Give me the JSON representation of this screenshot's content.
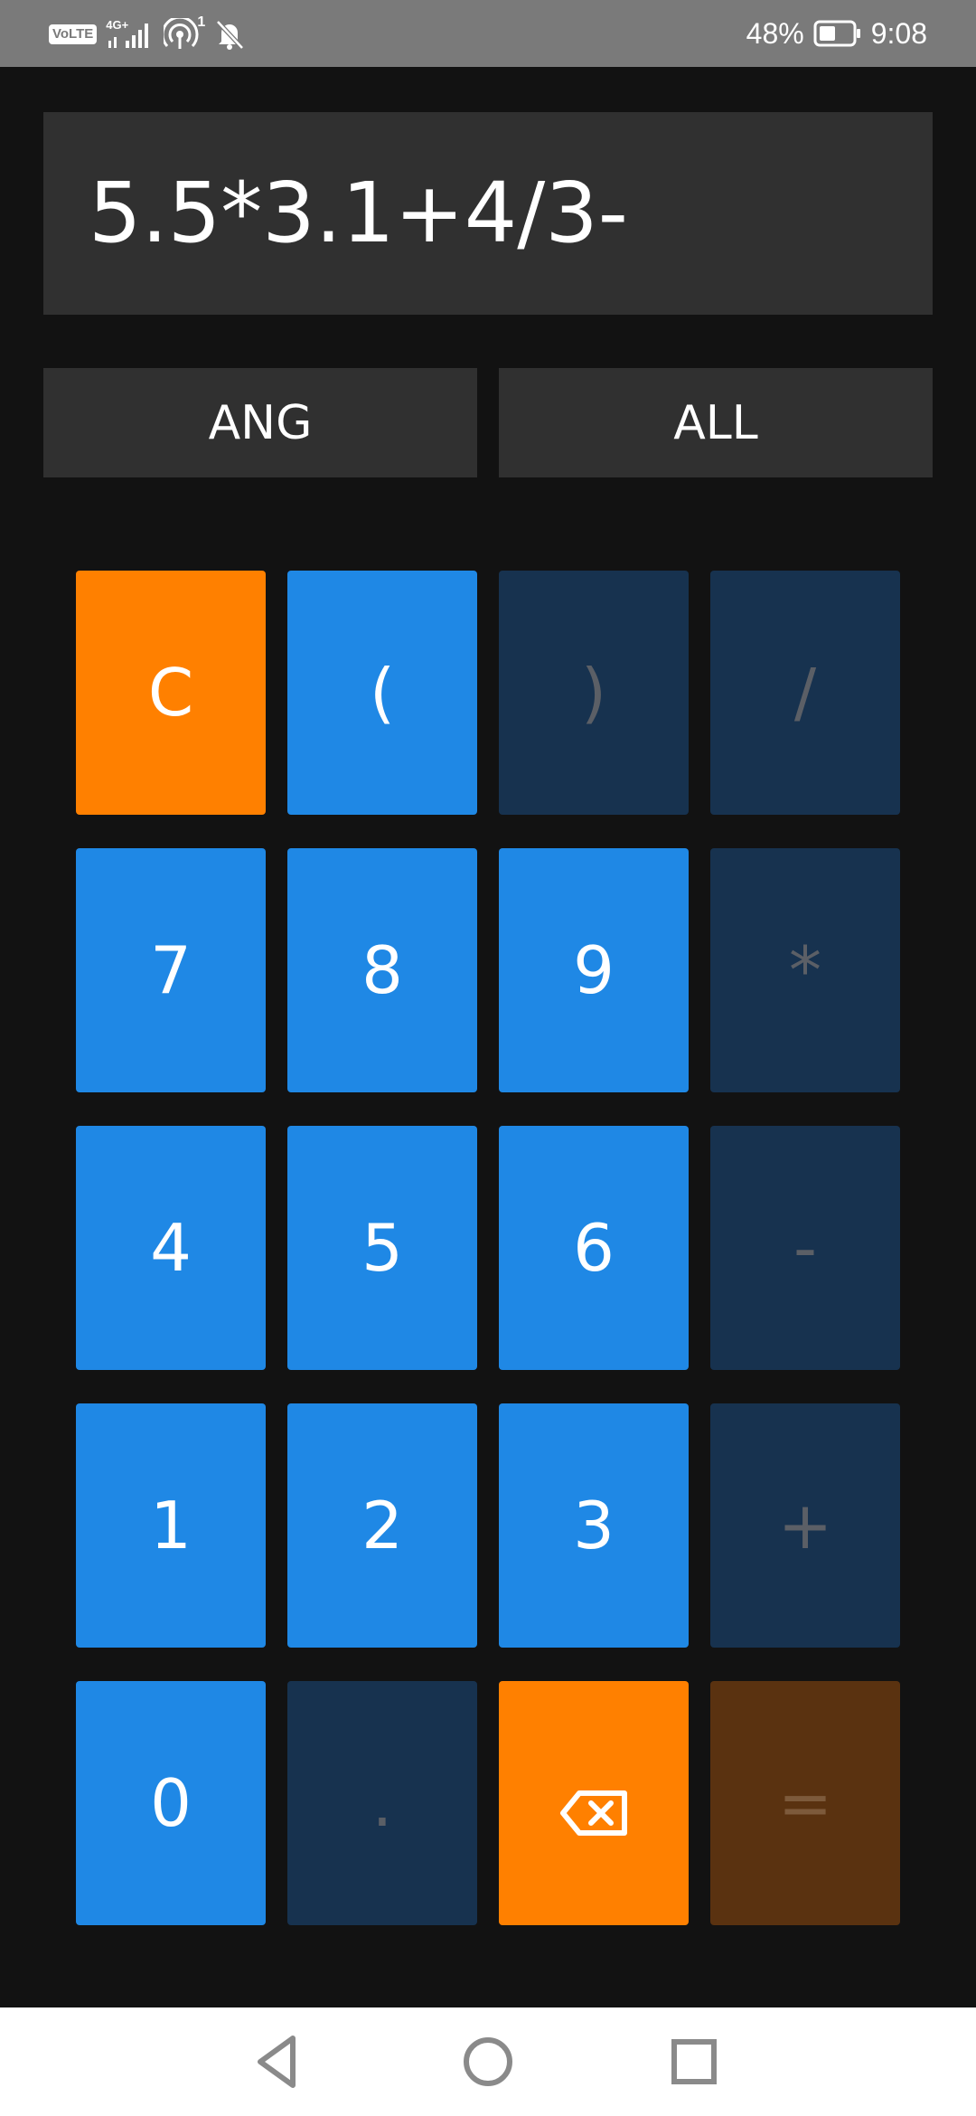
{
  "status_bar": {
    "volte": "VoLTE",
    "network": "4G+",
    "hotspot_count": "1",
    "battery": "48%",
    "time": "9:08",
    "icons": [
      "volte-icon",
      "signal-icon",
      "hotspot-icon",
      "bell-off-icon",
      "battery-icon"
    ]
  },
  "display": {
    "expression": "5.5*3.1+4/3-"
  },
  "modes": {
    "ang": "ANG",
    "all": "ALL"
  },
  "keys": {
    "clear": "C",
    "open_paren": "(",
    "close_paren": ")",
    "divide": "/",
    "seven": "7",
    "eight": "8",
    "nine": "9",
    "multiply": "*",
    "four": "4",
    "five": "5",
    "six": "6",
    "minus": "-",
    "one": "1",
    "two": "2",
    "three": "3",
    "plus": "+",
    "zero": "0",
    "dot": ".",
    "backspace_icon": "backspace-icon",
    "equals": "="
  },
  "navigation": {
    "icons": [
      "back-icon",
      "home-icon",
      "recents-icon"
    ]
  },
  "colors": {
    "background": "#121212",
    "status_bar": "#7a7a7a",
    "display_bg": "#303030",
    "key_blue": "#1f88e5",
    "key_orange": "#ff8000",
    "key_disabled": "#17324f",
    "key_equals": "#5a3210"
  }
}
